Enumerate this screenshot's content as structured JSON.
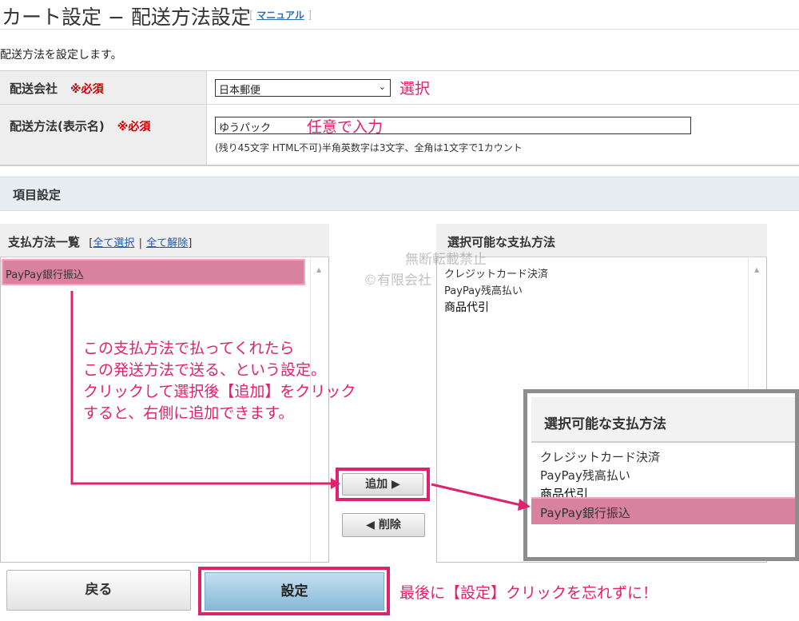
{
  "header": {
    "title": "カート設定 − 配送方法設定",
    "manual_open": "[",
    "manual_link": "マニュアル",
    "manual_close": "]",
    "intro": "配送方法を設定します。"
  },
  "form": {
    "carrier_label": "配送会社",
    "carrier_required": "※必須",
    "carrier_value": "日本郵便",
    "method_label": "配送方法(表示名)",
    "method_required": "※必須",
    "method_value": "ゆうパック",
    "method_help": "(残り45文字 HTML不可)半角英数字は3文字、全角は1文字で1カウント"
  },
  "section": {
    "title": "項目設定"
  },
  "payment_list": {
    "title": "支払方法一覧",
    "open": "[",
    "select_all": "全て選択",
    "sep": "|",
    "deselect_all": "全て解除",
    "close": "]",
    "items": [
      "PayPay銀行振込"
    ]
  },
  "available_list": {
    "title": "選択可能な支払方法",
    "items": [
      "クレジットカード決済",
      "PayPay残高払い",
      "商品代引"
    ]
  },
  "buttons": {
    "add": "追加 ▶",
    "remove": "◀ 削除",
    "back": "戻る",
    "save": "設定"
  },
  "zoom": {
    "title": "選択可能な支払方法",
    "items": [
      "クレジットカード決済",
      "PayPay残高払い",
      "商品代引",
      "PayPay銀行振込"
    ]
  },
  "annotations": {
    "select_note": "選択",
    "input_note": "任意で入力",
    "explain": [
      "この支払方法で払ってくれたら",
      "この発送方法で送る、という設定。",
      "クリックして選択後【追加】をクリック",
      "すると、右側に追加できます。"
    ],
    "final_note": "最後に【設定】クリックを忘れずに！"
  },
  "watermark": [
    "無断転載禁止",
    "©有限会社"
  ],
  "colors": {
    "accent": "#e0226c",
    "highlight": "#d9829f",
    "section_bg": "#e7eef3",
    "save_button": "#9cc8e2"
  }
}
